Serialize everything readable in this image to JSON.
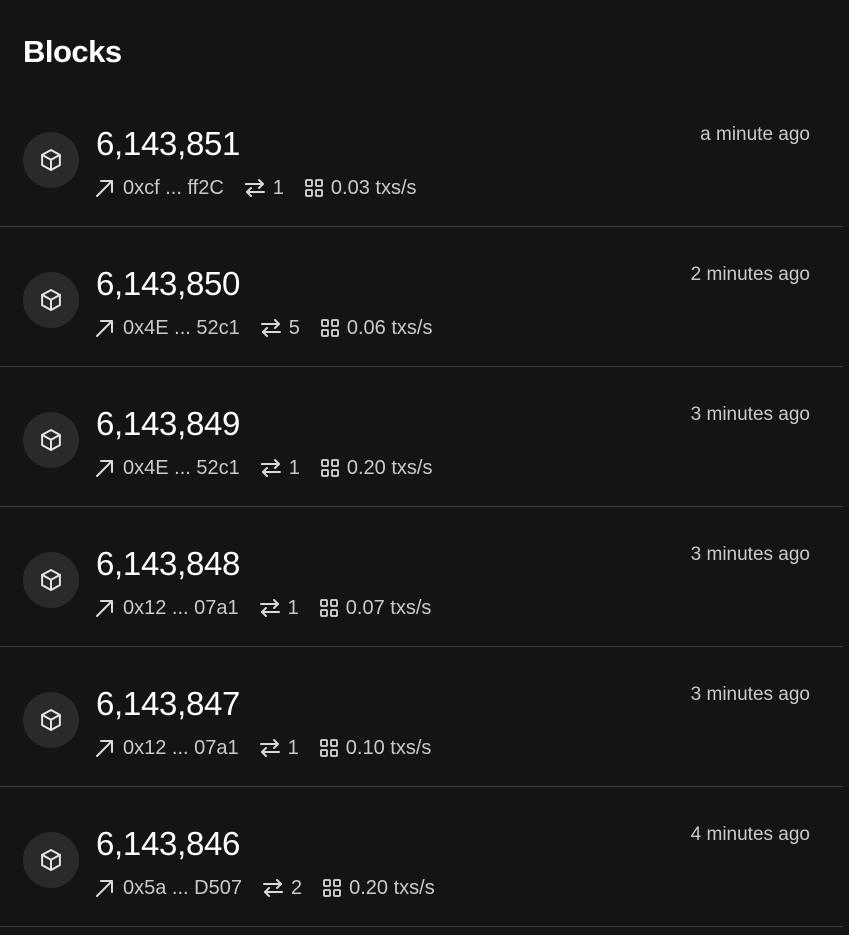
{
  "header": {
    "title": "Blocks"
  },
  "blocks": [
    {
      "number": "6,143,851",
      "miner": "0xcf ... ff2C",
      "tx_count": "1",
      "tps": "0.03 txs/s",
      "time": "a minute ago"
    },
    {
      "number": "6,143,850",
      "miner": "0x4E ... 52c1",
      "tx_count": "5",
      "tps": "0.06 txs/s",
      "time": "2 minutes ago"
    },
    {
      "number": "6,143,849",
      "miner": "0x4E ... 52c1",
      "tx_count": "1",
      "tps": "0.20 txs/s",
      "time": "3 minutes ago"
    },
    {
      "number": "6,143,848",
      "miner": "0x12 ... 07a1",
      "tx_count": "1",
      "tps": "0.07 txs/s",
      "time": "3 minutes ago"
    },
    {
      "number": "6,143,847",
      "miner": "0x12 ... 07a1",
      "tx_count": "1",
      "tps": "0.10 txs/s",
      "time": "3 minutes ago"
    },
    {
      "number": "6,143,846",
      "miner": "0x5a ... D507",
      "tx_count": "2",
      "tps": "0.20 txs/s",
      "time": "4 minutes ago"
    }
  ],
  "icons": {
    "block": "cube-icon",
    "miner": "arrow-up-right-icon",
    "transactions": "arrows-exchange-icon",
    "throughput": "grid-icon"
  },
  "colors": {
    "background": "#141414",
    "avatar_bg": "#2a2a2a",
    "divider": "#3a3a3a",
    "text_primary": "#ffffff",
    "text_secondary": "#c9c9c9"
  }
}
